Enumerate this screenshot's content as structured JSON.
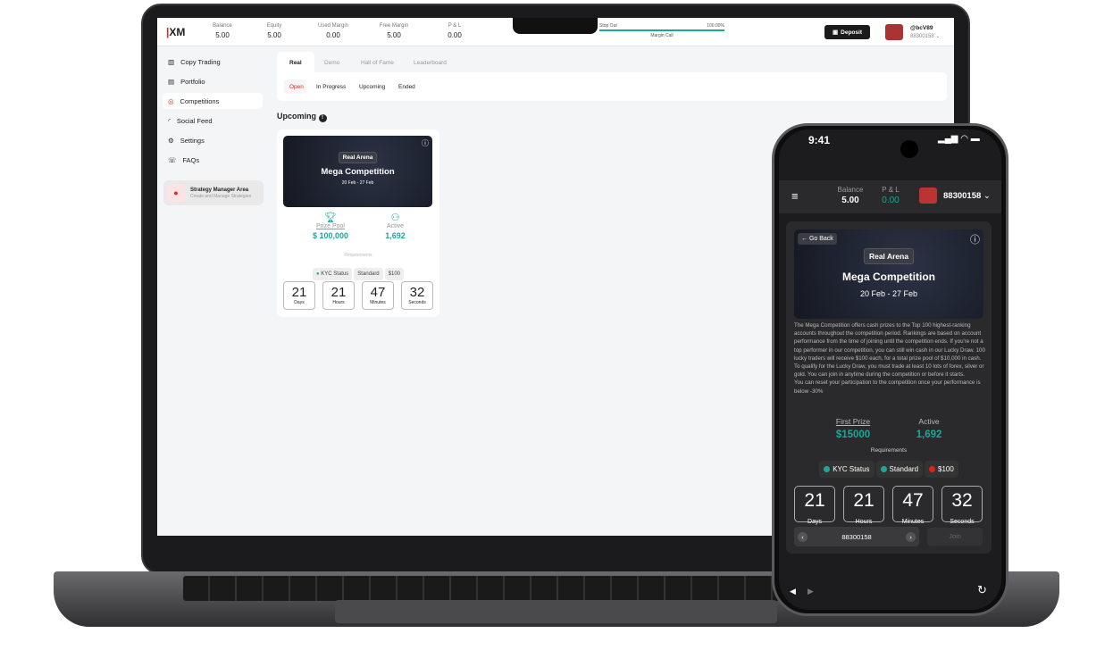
{
  "colors": {
    "accent": "#1aa89a",
    "brand": "#e2231a",
    "dark_bg": "#1c1c1e"
  },
  "desktop": {
    "logo": "XM",
    "stats": [
      {
        "label": "Balance",
        "value": "5.00"
      },
      {
        "label": "Equity",
        "value": "5.00"
      },
      {
        "label": "Used Margin",
        "value": "0.00"
      },
      {
        "label": "Free Margin",
        "value": "5.00"
      },
      {
        "label": "P & L",
        "value": "0.00"
      }
    ],
    "margin": {
      "stop_out": "Stop Out",
      "percent": "100.00%",
      "margin_call": "Margin Call"
    },
    "deposit": "Deposit",
    "user": {
      "name": "@bcV89",
      "account": "88300158"
    },
    "sidebar": [
      {
        "label": "Copy Trading",
        "icon": "bar-chart-icon"
      },
      {
        "label": "Portfolio",
        "icon": "briefcase-icon"
      },
      {
        "label": "Competitions",
        "icon": "award-icon"
      },
      {
        "label": "Social Feed",
        "icon": "rss-icon"
      },
      {
        "label": "Settings",
        "icon": "gear-icon"
      },
      {
        "label": "FAQs",
        "icon": "chat-icon"
      }
    ],
    "strategy": {
      "title": "Strategy Manager Area",
      "subtitle": "Create and Manage Strategies"
    },
    "tabs": [
      "Real",
      "Demo",
      "Hall of Fame",
      "Leaderboard"
    ],
    "subtabs": [
      "Open",
      "In Progress",
      "Upcoming",
      "Ended"
    ],
    "section_title": "Upcoming",
    "card": {
      "badge": "Real Arena",
      "title": "Mega Competition",
      "dates": "20 Feb - 27 Feb",
      "prize_label": "Prize Pool",
      "prize": "$ 100,000",
      "active_label": "Active",
      "active": "1,692",
      "req_label": "Requirements",
      "reqs": [
        "KYC Status",
        "Standard",
        "$100"
      ],
      "countdown": [
        {
          "v": "21",
          "l": "Days"
        },
        {
          "v": "21",
          "l": "Hours"
        },
        {
          "v": "47",
          "l": "Minutes"
        },
        {
          "v": "32",
          "l": "Seconds"
        }
      ]
    }
  },
  "mobile": {
    "time": "9:41",
    "balance_label": "Balance",
    "balance": "5.00",
    "pl_label": "P & L",
    "pl": "0.00",
    "account": "88300158",
    "go_back": "Go Back",
    "badge": "Real Arena",
    "title": "Mega Competition",
    "dates": "20 Feb - 27 Feb",
    "description": "The Mega Competition offers cash prizes to the Top 100 highest-ranking accounts throughout the competition period. Rankings are based on account performance from the time of joining until the competition ends. If you're not a top performer in our competition, you can still win cash in our Lucky Draw. 100 lucky traders will receive $100 each, for a total prize pool of $10,000 in cash. To qualify for the Lucky Draw, you must trade at least 10 lots of forex, silver or gold. You can join in anytime during the competition or before it starts.",
    "description2": "You can reset your participation to the competition once your performance is below -30%",
    "first_prize_label": "First Prize",
    "first_prize": "$15000",
    "active_label": "Active",
    "active": "1,692",
    "req_label": "Requirements",
    "reqs": [
      {
        "label": "KYC Status",
        "status": "ok"
      },
      {
        "label": "Standard",
        "status": "ok"
      },
      {
        "label": "$100",
        "status": "fail"
      }
    ],
    "countdown": [
      {
        "v": "21",
        "l": "Days"
      },
      {
        "v": "21",
        "l": "Hours"
      },
      {
        "v": "47",
        "l": "Minutes"
      },
      {
        "v": "32",
        "l": "Seconds"
      }
    ],
    "selector_account": "88300158",
    "join": "Join"
  }
}
